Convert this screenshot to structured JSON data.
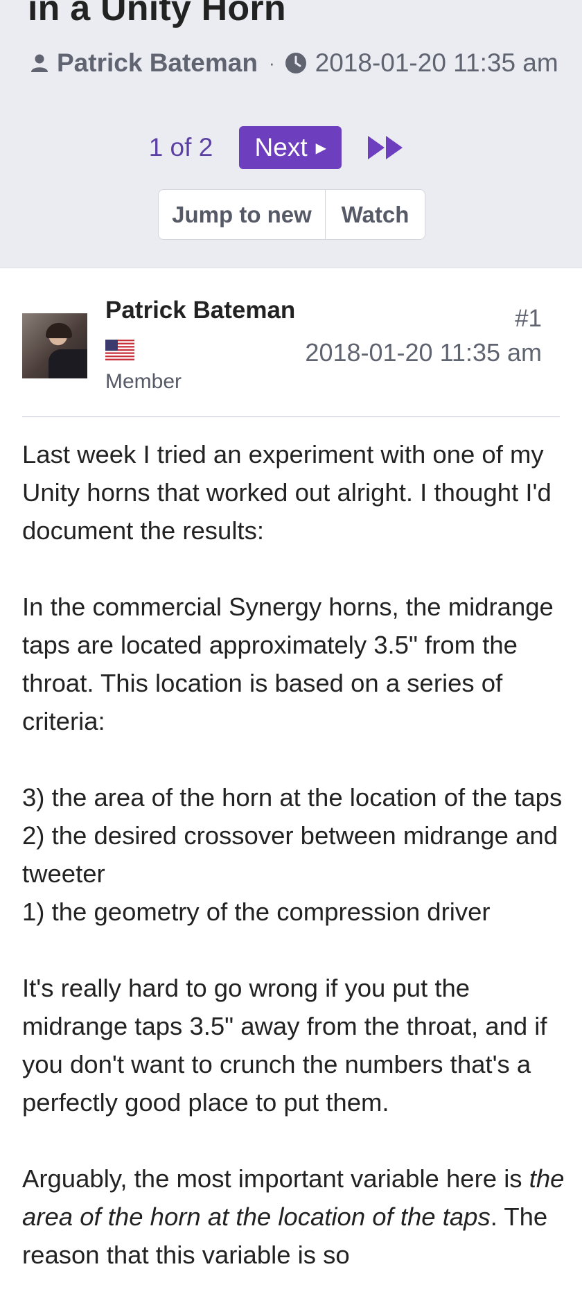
{
  "thread": {
    "title": "in a Unity Horn",
    "author": "Patrick Bateman",
    "date": "2018-01-20 11:35 am"
  },
  "pager": {
    "page_count": "1 of 2",
    "next_label": "Next"
  },
  "actions": {
    "jump_label": "Jump to new",
    "watch_label": "Watch"
  },
  "post": {
    "username": "Patrick Bateman",
    "role": "Member",
    "number": "#1",
    "date": "2018-01-20 11:35 am",
    "paragraphs": [
      "Last week I tried an experiment with one of my Unity horns that worked out alright. I thought I'd document the results:",
      "In the commercial Synergy horns, the midrange taps are located approximately 3.5\" from the throat. This location is based on a series of criteria:",
      "It's really hard to go wrong if you put the midrange taps 3.5\" away from the throat, and if you don't want to crunch the numbers that's a perfectly good place to put them."
    ],
    "criteria": [
      "3) the area of the horn at the location of the taps",
      "2) the desired crossover between midrange and tweeter",
      "1) the geometry of the compression driver"
    ],
    "last_paragraph": {
      "before": "Arguably, the most important variable here is ",
      "emphasis": "the area of the horn at the location of the taps",
      "after": ". The reason that this variable is so"
    }
  },
  "colors": {
    "accent": "#6d3fbe",
    "header_bg": "#eaecf2",
    "muted_text": "#5f6470"
  },
  "icons": [
    "user-icon",
    "clock-icon",
    "caret-right-icon",
    "last-page-icon",
    "us-flag-icon"
  ]
}
